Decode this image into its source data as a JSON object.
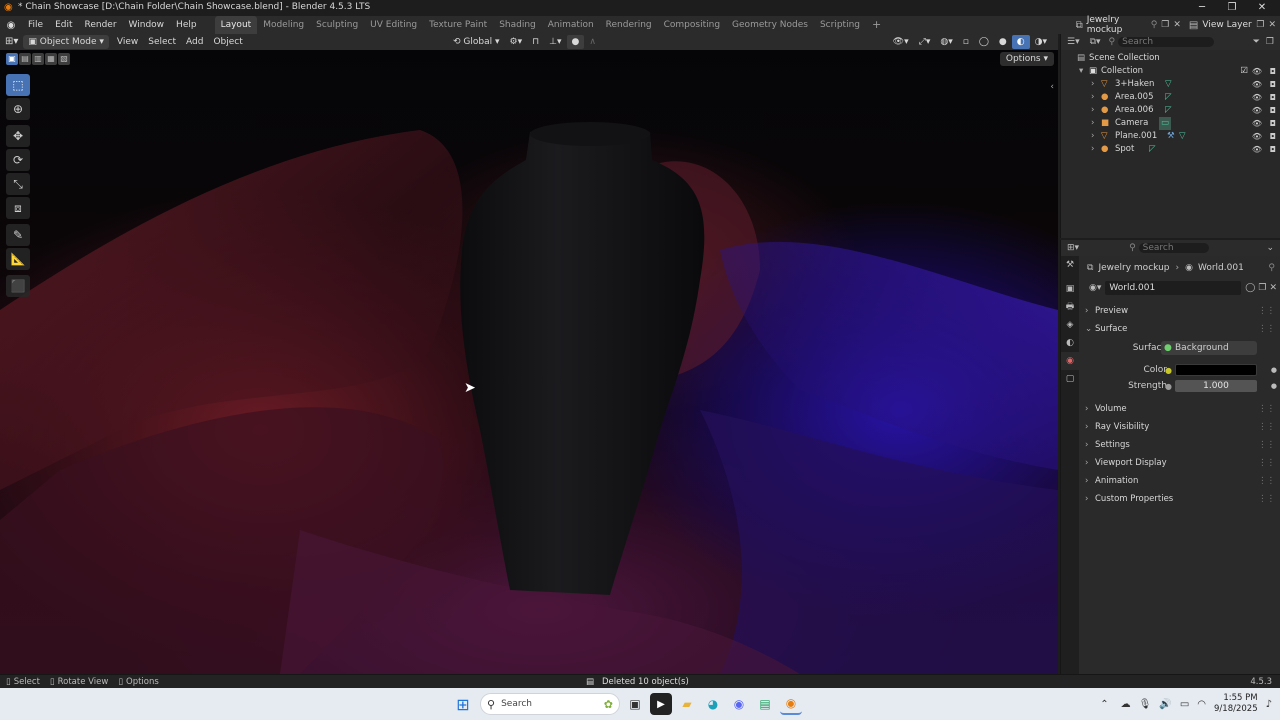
{
  "window": {
    "title": "* Chain Showcase [D:\\Chain Folder\\Chain Showcase.blend] - Blender 4.5.3 LTS",
    "controls": [
      "─",
      "❐",
      "✕"
    ]
  },
  "menu": {
    "items": [
      "File",
      "Edit",
      "Render",
      "Window",
      "Help"
    ],
    "workspaces": [
      "Layout",
      "Modeling",
      "Sculpting",
      "UV Editing",
      "Texture Paint",
      "Shading",
      "Animation",
      "Rendering",
      "Compositing",
      "Geometry Nodes",
      "Scripting"
    ],
    "active_workspace": "Layout",
    "add_tab": "+",
    "scene_name": "Jewelry mockup",
    "view_layer": "View Layer"
  },
  "viewport_header": {
    "mode": "Object Mode",
    "menus": [
      "View",
      "Select",
      "Add",
      "Object"
    ],
    "transform_orientation": "Global",
    "options_label": "Options"
  },
  "outliner": {
    "search_placeholder": "Search",
    "scene_collection": "Scene Collection",
    "collection": "Collection",
    "objects": [
      {
        "name": "3+Haken",
        "type": "mesh"
      },
      {
        "name": "Area.005",
        "type": "light"
      },
      {
        "name": "Area.006",
        "type": "light"
      },
      {
        "name": "Camera",
        "type": "camera"
      },
      {
        "name": "Plane.001",
        "type": "mesh"
      },
      {
        "name": "Spot",
        "type": "light"
      }
    ]
  },
  "properties": {
    "search_placeholder": "Search",
    "breadcrumb_scene": "Jewelry mockup",
    "breadcrumb_world": "World.001",
    "world_name": "World.001",
    "panels": {
      "preview": "Preview",
      "surface": "Surface",
      "volume": "Volume",
      "ray_visibility": "Ray Visibility",
      "settings": "Settings",
      "viewport_display": "Viewport Display",
      "animation": "Animation",
      "custom_properties": "Custom Properties"
    },
    "surface_label": "Surface",
    "surface_value": "Background",
    "color_label": "Color",
    "color_value": "#000000",
    "strength_label": "Strength",
    "strength_value": "1.000"
  },
  "statusbar": {
    "select": "Select",
    "rotate_view": "Rotate View",
    "options": "Options",
    "message": "Deleted 10 object(s)",
    "version": "4.5.3"
  },
  "taskbar": {
    "search_placeholder": "Search",
    "time": "1:55 PM",
    "date": "9/18/2025"
  },
  "colors": {
    "accent": "#4772b3",
    "active_tab": "#e06666"
  }
}
